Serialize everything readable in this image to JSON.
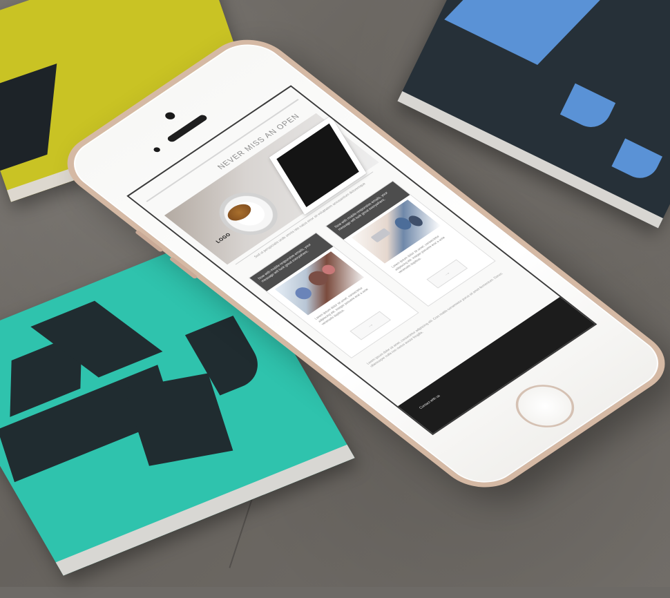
{
  "scene": {
    "background_description_color": "#6d6a66"
  },
  "books": {
    "yellow": "#c9c324",
    "blue": "#5a92d6",
    "teal": "#2fc3ad",
    "dark": "#202c30"
  },
  "phone": {
    "headline": "NEVER MISS AN OPEN",
    "logo": "LOGO",
    "hero_caption": "Sed ut perspiciatis unde omnis iste natus error sit voluptatem accusantium doloremque",
    "card_left_header": "Now with mobile-responsive emails, your message will look great everywhere.",
    "card_right_header": "Now with mobile-responsive emails, your message will look great everywhere.",
    "card_left_text": "Lorem ipsum dolor sit amet, consectetur adipiscing elit. Integer posuere erat a ante venenatis dapibus.",
    "card_right_text": "Lorem ipsum dolor sit amet, consectetur adipiscing elit. Integer posuere erat a ante venenatis dapibus.",
    "arrow": "→",
    "footer_text": "Lorem ipsum dolor sit amet, consectetur adipiscing elit. Cras mattis consectetur purus sit amet fermentum. Donec ullamcorper nulla non metus auctor fringilla.",
    "footer_label": "Contact with us"
  }
}
